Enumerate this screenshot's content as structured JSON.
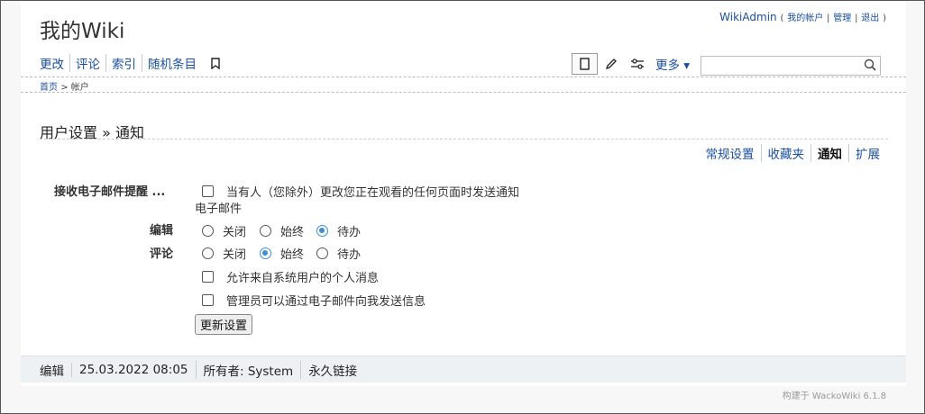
{
  "site": {
    "title": "我的Wiki"
  },
  "user": {
    "name": "WikiAdmin",
    "open": "(",
    "account": "我的帐户",
    "sep1": "|",
    "manage": "管理",
    "sep2": "|",
    "logout": "退出",
    "close": ")"
  },
  "nav": {
    "items": [
      "更改",
      "评论",
      "索引",
      "随机条目"
    ],
    "bookmark_icon": "bookmark-icon"
  },
  "tools": {
    "more_label": "更多 ▾",
    "search_placeholder": ""
  },
  "breadcrumb": {
    "home": "首页",
    "sep": ">",
    "current": "帐户"
  },
  "page": {
    "title": "用户设置 » 通知"
  },
  "subtabs": [
    "常规设置",
    "收藏夹",
    "通知",
    "扩展"
  ],
  "form": {
    "email_label": "接收电子邮件提醒 ...",
    "watch_text_1": "当有人（您除外）更改您正在观看的任何页面时发送通知",
    "watch_text_2": "电子邮件",
    "edit_label": "编辑",
    "comment_label": "评论",
    "radio_off": "关闭",
    "radio_always": "始终",
    "radio_pending": "待办",
    "edit_value": "待办",
    "comment_value": "始终",
    "pm_text": "允许来自系统用户的个人消息",
    "admin_email_text": "管理员可以通过电子邮件向我发送信息",
    "update_button": "更新设置"
  },
  "footer": {
    "edit": "编辑",
    "date": "25.03.2022 08:05",
    "owner": "所有者: System",
    "permalink": "永久链接"
  },
  "powered": "构建于 WackoWiki 6.1.8",
  "colors": {
    "link": "#1a4fa0",
    "radio_accent": "#3b8fd9",
    "footer_bg": "#eef1f3"
  }
}
